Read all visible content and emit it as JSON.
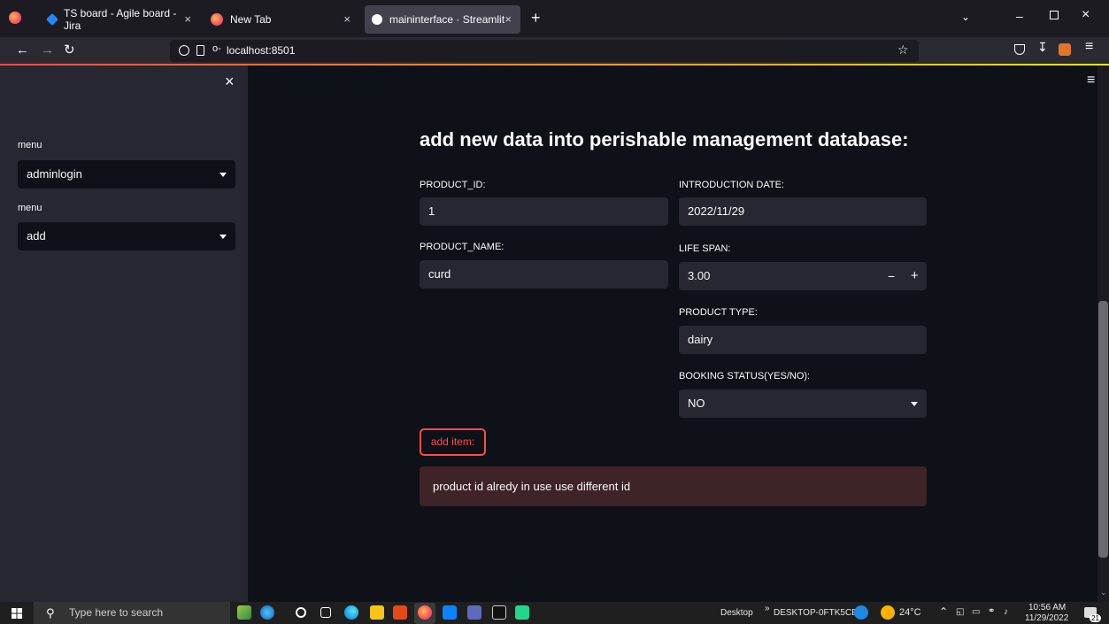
{
  "browser": {
    "tabs": [
      {
        "label": "TS board - Agile board - Jira",
        "active": false
      },
      {
        "label": "New Tab",
        "active": false
      },
      {
        "label": "maininterface · Streamlit",
        "active": true
      }
    ],
    "new_tab_glyph": "+",
    "url": "localhost:8501"
  },
  "sidebar": {
    "close_glyph": "×",
    "menu1_label": "menu",
    "menu1_value": "adminlogin",
    "menu2_label": "menu",
    "menu2_value": "add"
  },
  "main": {
    "hamburger_glyph": "≡",
    "title": "add new data into perishable management database:",
    "product_id_label": "PRODUCT_ID:",
    "product_id_value": "1",
    "product_name_label": "PRODUCT_NAME:",
    "product_name_value": "curd",
    "intro_date_label": "INTRODUCTION DATE:",
    "intro_date_value": "2022/11/29",
    "life_span_label": "LIFE SPAN:",
    "life_span_value": "3.00",
    "minus_glyph": "−",
    "plus_glyph": "+",
    "product_type_label": "PRODUCT TYPE:",
    "product_type_value": "dairy",
    "booking_label": "BOOKING STATUS(YES/NO):",
    "booking_value": "NO",
    "add_button_label": "add item:",
    "error_message": "product id alredy in use use different id"
  },
  "taskbar": {
    "search_placeholder": "Type here to search",
    "desktop_label": "Desktop",
    "computer_name": "DESKTOP-0FTK5CE",
    "temperature": "24°C",
    "time": "10:56 AM",
    "date": "11/29/2022",
    "notification_count": "21"
  },
  "colors": {
    "accent_red": "#ff4b4b",
    "sidebar_bg": "#262730",
    "main_bg": "#0e1117",
    "error_bg": "#3e2327"
  }
}
